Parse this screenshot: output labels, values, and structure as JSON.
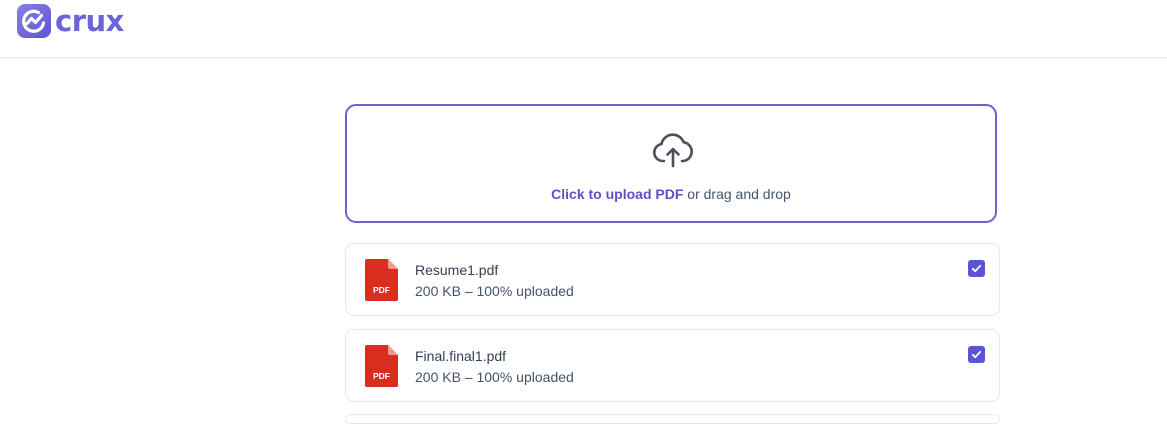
{
  "header": {
    "logo_text": "crux",
    "logo_icon": "crux-logo-icon",
    "brand_color": "#6b63d6"
  },
  "upload": {
    "icon": "cloud-upload-icon",
    "link_text": "Click to upload PDF",
    "suffix_text": " or drag and drop",
    "accent_color": "#5b52c9"
  },
  "files": [
    {
      "icon": "pdf-file-icon",
      "icon_label": "PDF",
      "name": "Resume1.pdf",
      "meta": "200 KB – 100% uploaded",
      "progress_percent": 100,
      "checked": true
    },
    {
      "icon": "pdf-file-icon",
      "icon_label": "PDF",
      "name": "Final.final1.pdf",
      "meta": "200 KB – 100% uploaded",
      "progress_percent": 100,
      "checked": true
    }
  ],
  "colors": {
    "pdf_red": "#d92d20",
    "checkbox": "#5b55d6",
    "card_border": "#e7e8ec"
  }
}
